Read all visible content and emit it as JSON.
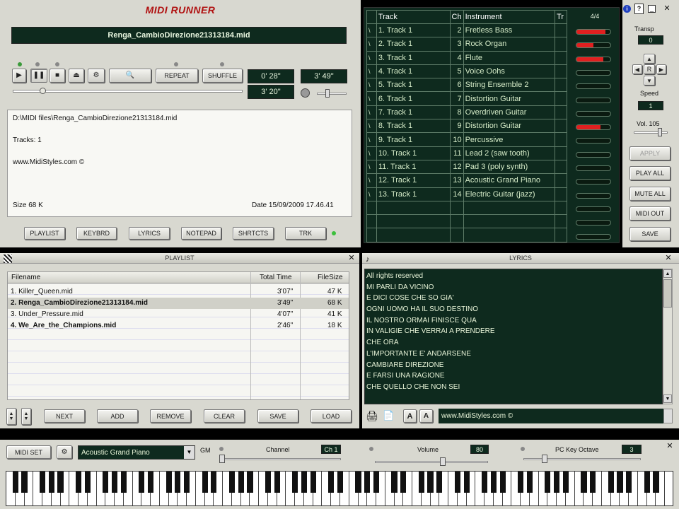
{
  "app_title": "MIDI RUNNER",
  "now_playing": "Renga_CambioDirezione21313184.mid",
  "transport": {
    "repeat": "REPEAT",
    "shuffle": "SHUFFLE",
    "elapsed": "0' 28\"",
    "remaining": "3' 20\"",
    "total": "3' 49\""
  },
  "info": {
    "path": "D:\\MIDI files\\Renga_CambioDirezione21313184.mid",
    "tracks": "Tracks: 1",
    "site": "www.MidiStyles.com ©",
    "size": "Size 68 K",
    "date": "Date 15/09/2009 17.46.41"
  },
  "nav_buttons": [
    "PLAYLIST",
    "KEYBRD",
    "LYRICS",
    "NOTEPAD",
    "SHRTCTS",
    "TRK"
  ],
  "tracks": {
    "headers": [
      "Track",
      "Ch",
      "Instrument",
      "Tr"
    ],
    "time_sig": "4/4",
    "rows": [
      {
        "track": "1. Track 1",
        "ch": "2",
        "inst": "Fretless Bass",
        "level": 0.85
      },
      {
        "track": "2. Track 1",
        "ch": "3",
        "inst": "Rock Organ",
        "level": 0.5
      },
      {
        "track": "3. Track 1",
        "ch": "4",
        "inst": "Flute",
        "level": 0.8
      },
      {
        "track": "4. Track 1",
        "ch": "5",
        "inst": "Voice Oohs",
        "level": 0
      },
      {
        "track": "5. Track 1",
        "ch": "6",
        "inst": "String Ensemble 2",
        "level": 0
      },
      {
        "track": "6. Track 1",
        "ch": "7",
        "inst": "Distortion Guitar",
        "level": 0
      },
      {
        "track": "7. Track 1",
        "ch": "8",
        "inst": "Overdriven Guitar",
        "level": 0
      },
      {
        "track": "8. Track 1",
        "ch": "9",
        "inst": "Distortion Guitar",
        "level": 0.7
      },
      {
        "track": "9. Track 1",
        "ch": "10",
        "inst": "Percussive",
        "level": 0
      },
      {
        "track": "10. Track 1",
        "ch": "11",
        "inst": "Lead 2 (saw tooth)",
        "level": 0
      },
      {
        "track": "11. Track 1",
        "ch": "12",
        "inst": "Pad 3 (poly synth)",
        "level": 0
      },
      {
        "track": "12. Track 1",
        "ch": "13",
        "inst": "Acoustic Grand Piano",
        "level": 0
      },
      {
        "track": "13. Track 1",
        "ch": "14",
        "inst": "Electric Guitar (jazz)",
        "level": 0
      }
    ]
  },
  "side": {
    "transp_label": "Transp",
    "transp_value": "0",
    "reset": "R",
    "speed_label": "Speed",
    "speed_value": "1",
    "vol_label": "Vol. 105",
    "apply": "APPLY",
    "play_all": "PLAY ALL",
    "mute_all": "MUTE ALL",
    "midi_out": "MIDI OUT",
    "save": "SAVE"
  },
  "playlist": {
    "title": "PLAYLIST",
    "headers": [
      "Filename",
      "Total Time",
      "FileSize"
    ],
    "rows": [
      {
        "name": "1. Killer_Queen.mid",
        "time": "3'07\"",
        "size": "47 K",
        "bold": false,
        "selected": false
      },
      {
        "name": "2. Renga_CambioDirezione21313184.mid",
        "time": "3'49\"",
        "size": "68 K",
        "bold": true,
        "selected": true
      },
      {
        "name": "3. Under_Pressure.mid",
        "time": "4'07\"",
        "size": "41 K",
        "bold": false,
        "selected": false
      },
      {
        "name": "4. We_Are_the_Champions.mid",
        "time": "2'46\"",
        "size": "18 K",
        "bold": true,
        "selected": false
      }
    ],
    "buttons": [
      "NEXT",
      "ADD",
      "REMOVE",
      "CLEAR",
      "SAVE",
      "LOAD"
    ]
  },
  "lyrics": {
    "title": "LYRICS",
    "lines": [
      "All rights reserved",
      "MI PARLI DA VICINO",
      "E DICI COSE CHE SO GIA'",
      "OGNI UOMO HA IL SUO DESTINO",
      "IL NOSTRO ORMAI FINISCE QUA",
      "IN VALIGIE CHE VERRAI A PRENDERE",
      "CHE ORA",
      "L'IMPORTANTE E' ANDARSENE",
      "CAMBIARE DIREZIONE",
      "E FARSI UNA RAGIONE",
      "CHE QUELLO CHE NON SEI"
    ],
    "footer": "www.MidiStyles.com ©",
    "font_a": "A"
  },
  "keyboard": {
    "midi_set": "MIDI SET",
    "instrument": "Acoustic Grand Piano",
    "gm": "GM",
    "channel_label": "Channel",
    "channel_value": "Ch 1",
    "volume_label": "Volume",
    "volume_value": "80",
    "octave_label": "PC Key Octave",
    "octave_value": "3"
  },
  "colors": {
    "lcd": "#0e2a1e",
    "panel": "#d8d8d0",
    "meter": "#e02020",
    "title_red": "#b01010"
  }
}
